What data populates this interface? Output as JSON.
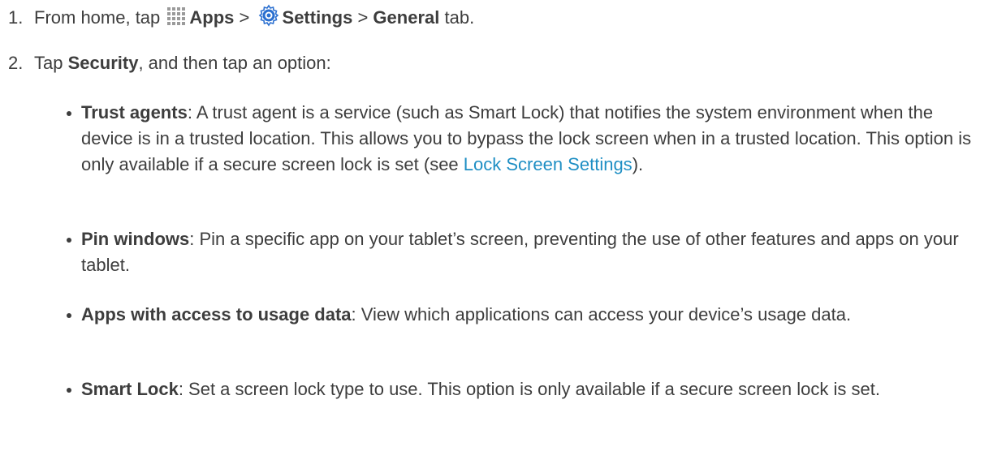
{
  "step1": {
    "number": "1.",
    "text_before": "From home, tap",
    "apps_label": "Apps",
    "sep1": ">",
    "settings_label": "Settings",
    "sep2": ">",
    "general_label": "General",
    "text_after": "tab.",
    "icons": [
      "apps-grid-icon",
      "settings-gear-icon"
    ]
  },
  "step2": {
    "number": "2.",
    "text_before": "Tap",
    "security_label": "Security",
    "text_after": ", and then tap an option:"
  },
  "options": [
    {
      "term": "Trust agents",
      "description": ": A trust agent is a service (such as Smart Lock) that notifies the system environment when the device is in a trusted location. This allows you to bypass the lock screen when in a trusted location. This option is only available if a secure screen lock is set (see ",
      "link_text": "Lock Screen Settings",
      "description_end": ")."
    },
    {
      "term": "Pin windows",
      "description": ": Pin a specific app on your tablet’s screen, preventing the use of other features and apps on your tablet."
    },
    {
      "term": "Apps with access to usage data",
      "description": ": View which applications can access your device’s usage data."
    },
    {
      "term": "Smart Lock",
      "description": ": Set a screen lock type to use. This option is only available if a secure screen lock is set."
    }
  ],
  "colors": {
    "text": "#3d3d3d",
    "link": "#1f8fc4",
    "apps_icon": "#9a9a9a",
    "settings_icon": "#2a6fd0"
  }
}
